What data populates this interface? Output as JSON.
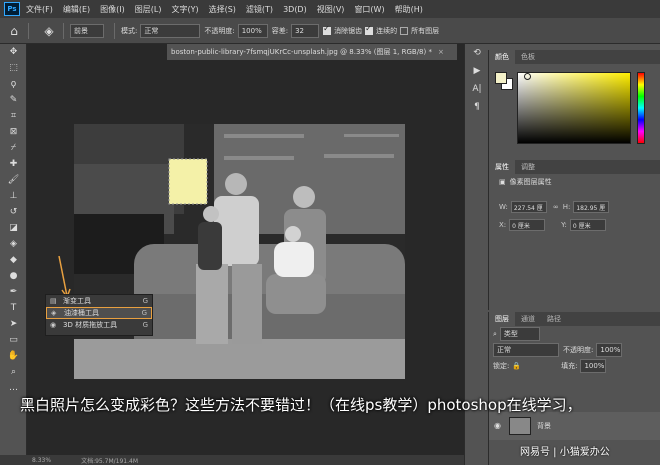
{
  "menubar": {
    "logo": "Ps",
    "items": [
      "文件(F)",
      "编辑(E)",
      "图像(I)",
      "图层(L)",
      "文字(Y)",
      "选择(S)",
      "滤镜(T)",
      "3D(D)",
      "视图(V)",
      "窗口(W)",
      "帮助(H)"
    ]
  },
  "options": {
    "preset_label": "前景",
    "mode_label": "模式:",
    "mode_value": "正常",
    "opacity_label": "不透明度:",
    "opacity_value": "100%",
    "tolerance_label": "容差:",
    "tolerance_value": "32",
    "antialias_label": "消除锯齿",
    "contiguous_label": "连续的",
    "all_layers_label": "所有图层"
  },
  "document": {
    "tab_title": "boston-public-library-7fsmqjUKrCc-unsplash.jpg @ 8.33% (图层 1, RGB/8) *",
    "tab_close": "×"
  },
  "flyout": {
    "items": [
      {
        "label": "渐变工具",
        "key": "G"
      },
      {
        "label": "油漆桶工具",
        "key": "G"
      },
      {
        "label": "3D 材质拖放工具",
        "key": "G"
      }
    ]
  },
  "status": {
    "zoom": "8.33%",
    "doc_size": "文档:95.7M/191.4M"
  },
  "color_panel": {
    "tabs": [
      "颜色",
      "色板"
    ],
    "foreground": "#f4f1c8",
    "background": "#ffffff"
  },
  "props_panel": {
    "tabs": [
      "属性",
      "调整"
    ],
    "title": "像素图层属性",
    "w_label": "W:",
    "w_value": "227.54 厘",
    "link_icon": "∞",
    "h_label": "H:",
    "h_value": "182.95 厘",
    "x_label": "X:",
    "x_value": "0 厘米",
    "y_label": "Y:",
    "y_value": "0 厘米"
  },
  "layers_panel": {
    "tabs": [
      "图层",
      "通道",
      "路径"
    ],
    "kind_label": "类型",
    "blend_mode": "正常",
    "opacity_label": "不透明度:",
    "opacity_value": "100%",
    "lock_label": "锁定:",
    "fill_label": "填充:",
    "fill_value": "100%",
    "layer_name": "背景"
  },
  "overlay": {
    "title": "黑白照片怎么变成彩色？这些方法不要错过！（在线ps教学）photoshop在线学习，",
    "watermark": "网易号 | 小猫爱办公"
  }
}
